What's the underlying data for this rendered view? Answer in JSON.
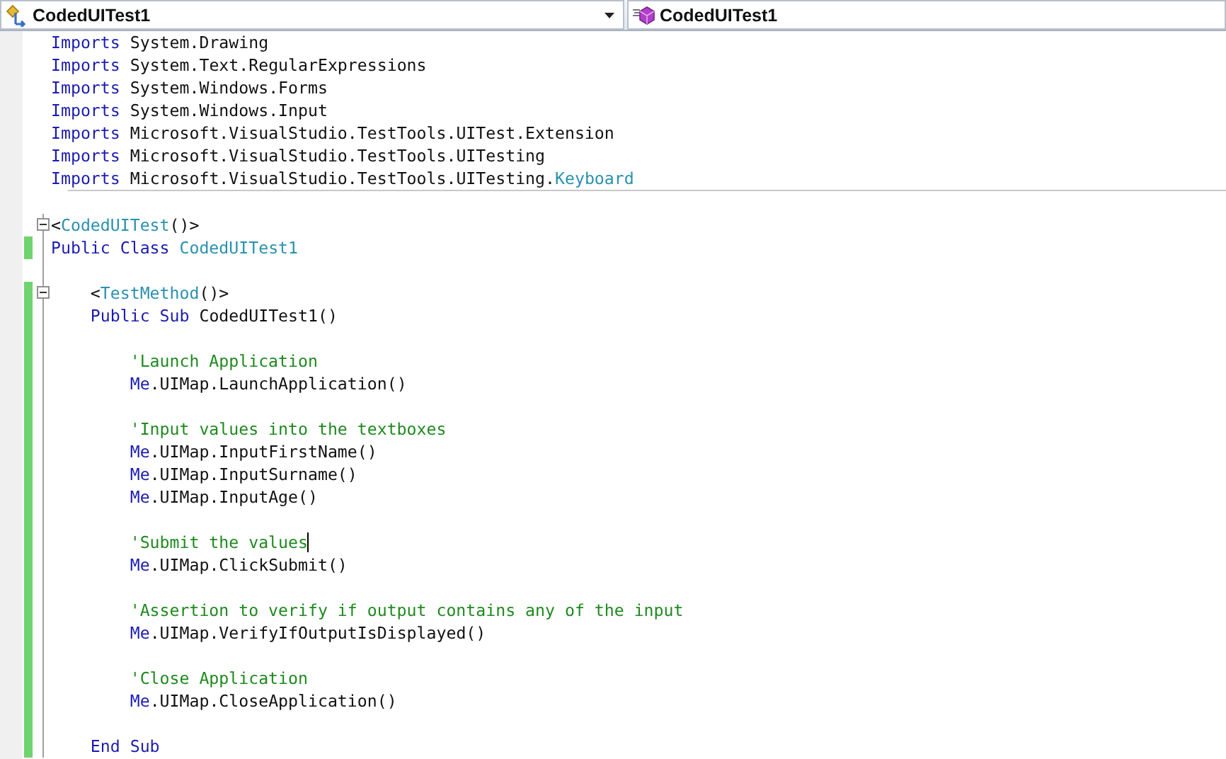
{
  "navigation_bar": {
    "type_dropdown": {
      "label": "CodedUITest1"
    },
    "member_dropdown": {
      "label": "CodedUITest1"
    }
  },
  "editor": {
    "imports": [
      {
        "tokens": [
          {
            "kind": "keyword",
            "text": "Imports"
          },
          {
            "kind": "plain",
            "text": " System.Drawing"
          }
        ]
      },
      {
        "tokens": [
          {
            "kind": "keyword",
            "text": "Imports"
          },
          {
            "kind": "plain",
            "text": " System.Text.RegularExpressions"
          }
        ]
      },
      {
        "tokens": [
          {
            "kind": "keyword",
            "text": "Imports"
          },
          {
            "kind": "plain",
            "text": " System.Windows.Forms"
          }
        ]
      },
      {
        "tokens": [
          {
            "kind": "keyword",
            "text": "Imports"
          },
          {
            "kind": "plain",
            "text": " System.Windows.Input"
          }
        ]
      },
      {
        "tokens": [
          {
            "kind": "keyword",
            "text": "Imports"
          },
          {
            "kind": "plain",
            "text": " Microsoft.VisualStudio.TestTools.UITest.Extension"
          }
        ]
      },
      {
        "tokens": [
          {
            "kind": "keyword",
            "text": "Imports"
          },
          {
            "kind": "plain",
            "text": " Microsoft.VisualStudio.TestTools.UITesting"
          }
        ]
      },
      {
        "tokens": [
          {
            "kind": "keyword",
            "text": "Imports"
          },
          {
            "kind": "plain",
            "text": " Microsoft.VisualStudio.TestTools.UITesting."
          },
          {
            "kind": "type",
            "text": "Keyboard"
          }
        ]
      }
    ],
    "lines": [
      {
        "modified": false
      },
      {
        "modified": false,
        "expanded": true,
        "tokens": [
          {
            "kind": "plain",
            "text": "<"
          },
          {
            "kind": "type",
            "text": "CodedUITest"
          },
          {
            "kind": "plain",
            "text": "()>"
          }
        ]
      },
      {
        "modified": true,
        "tokens": [
          {
            "kind": "keyword",
            "text": "Public Class"
          },
          {
            "kind": "type",
            "text": " CodedUITest1"
          }
        ]
      },
      {
        "modified": false
      },
      {
        "modified": true,
        "expanded": true,
        "tokens": [
          {
            "kind": "plain",
            "text": "    <"
          },
          {
            "kind": "type",
            "text": "TestMethod"
          },
          {
            "kind": "plain",
            "text": "()>"
          }
        ]
      },
      {
        "modified": true,
        "tokens": [
          {
            "kind": "keyword",
            "text": "    Public Sub"
          },
          {
            "kind": "plain",
            "text": " CodedUITest1()"
          }
        ]
      },
      {
        "modified": true
      },
      {
        "modified": true,
        "tokens": [
          {
            "kind": "comment",
            "text": "        'Launch Application"
          }
        ]
      },
      {
        "modified": true,
        "tokens": [
          {
            "kind": "keyword",
            "text": "        Me"
          },
          {
            "kind": "plain",
            "text": ".UIMap.LaunchApplication()"
          }
        ]
      },
      {
        "modified": true
      },
      {
        "modified": true,
        "tokens": [
          {
            "kind": "comment",
            "text": "        'Input values into the textboxes"
          }
        ]
      },
      {
        "modified": true,
        "tokens": [
          {
            "kind": "keyword",
            "text": "        Me"
          },
          {
            "kind": "plain",
            "text": ".UIMap.InputFirstName()"
          }
        ]
      },
      {
        "modified": true,
        "tokens": [
          {
            "kind": "keyword",
            "text": "        Me"
          },
          {
            "kind": "plain",
            "text": ".UIMap.InputSurname()"
          }
        ]
      },
      {
        "modified": true,
        "tokens": [
          {
            "kind": "keyword",
            "text": "        Me"
          },
          {
            "kind": "plain",
            "text": ".UIMap.InputAge()"
          }
        ]
      },
      {
        "modified": true
      },
      {
        "modified": true,
        "caret": true,
        "tokens": [
          {
            "kind": "comment",
            "text": "        'Submit the values"
          }
        ]
      },
      {
        "modified": true,
        "tokens": [
          {
            "kind": "keyword",
            "text": "        Me"
          },
          {
            "kind": "plain",
            "text": ".UIMap.ClickSubmit()"
          }
        ]
      },
      {
        "modified": true
      },
      {
        "modified": true,
        "tokens": [
          {
            "kind": "comment",
            "text": "        'Assertion to verify if output contains any of the input"
          }
        ]
      },
      {
        "modified": true,
        "tokens": [
          {
            "kind": "keyword",
            "text": "        Me"
          },
          {
            "kind": "plain",
            "text": ".UIMap.VerifyIfOutputIsDisplayed()"
          }
        ]
      },
      {
        "modified": true
      },
      {
        "modified": true,
        "tokens": [
          {
            "kind": "comment",
            "text": "        'Close Application"
          }
        ]
      },
      {
        "modified": true,
        "tokens": [
          {
            "kind": "keyword",
            "text": "        Me"
          },
          {
            "kind": "plain",
            "text": ".UIMap.CloseApplication()"
          }
        ]
      },
      {
        "modified": true
      },
      {
        "modified": true,
        "tokens": [
          {
            "kind": "keyword",
            "text": "    End Sub"
          }
        ]
      }
    ]
  }
}
